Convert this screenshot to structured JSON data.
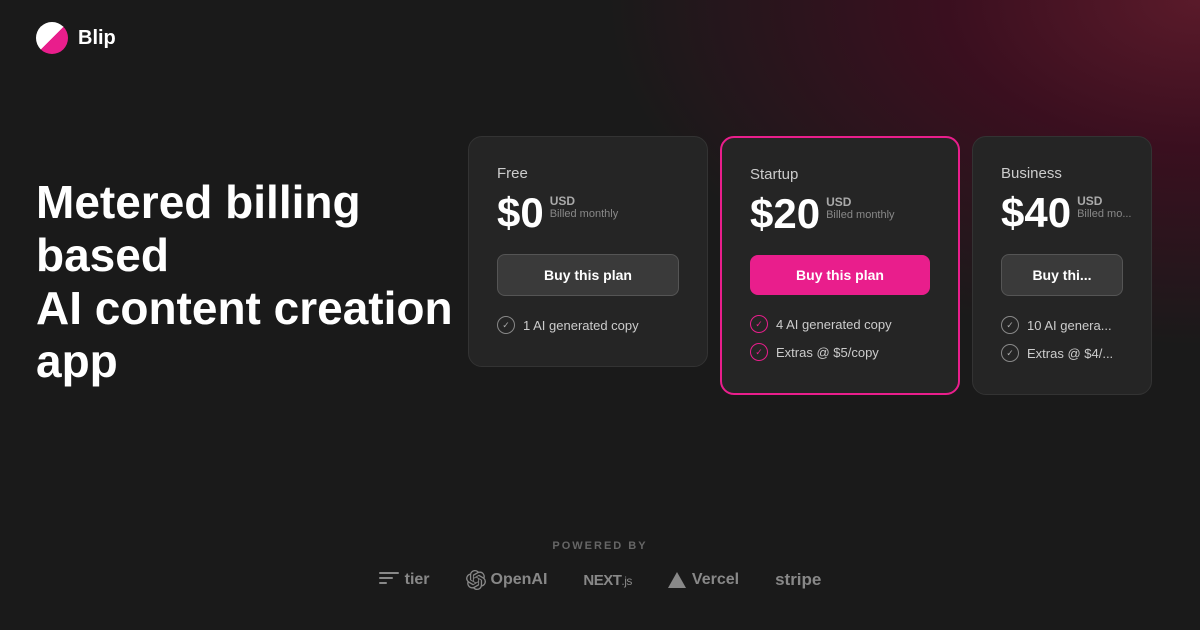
{
  "app": {
    "name": "Blip"
  },
  "hero": {
    "title_line1": "Metered billing based",
    "title_line2": "AI content creation app"
  },
  "plans": [
    {
      "id": "free",
      "name": "Free",
      "price": "$0",
      "currency": "USD",
      "billing": "Billed monthly",
      "button_label": "Buy this plan",
      "button_type": "default",
      "features": [
        "1 AI generated copy"
      ]
    },
    {
      "id": "startup",
      "name": "Startup",
      "price": "$20",
      "currency": "USD",
      "billing": "Billed monthly",
      "button_label": "Buy this plan",
      "button_type": "primary",
      "features": [
        "4 AI generated copy",
        "Extras @ $5/copy"
      ],
      "featured": true
    },
    {
      "id": "business",
      "name": "Business",
      "price": "$40",
      "currency": "USD",
      "billing": "Billed mo...",
      "button_label": "Buy thi...",
      "button_type": "default",
      "features": [
        "10 AI genera...",
        "Extras @ $4/..."
      ]
    }
  ],
  "footer": {
    "powered_by_label": "POWERED BY",
    "logos": [
      {
        "id": "tier",
        "label": "tier"
      },
      {
        "id": "openai",
        "label": "OpenAI"
      },
      {
        "id": "nextjs",
        "label": "NEXT.js"
      },
      {
        "id": "vercel",
        "label": "Vercel"
      },
      {
        "id": "stripe",
        "label": "stripe"
      }
    ]
  }
}
